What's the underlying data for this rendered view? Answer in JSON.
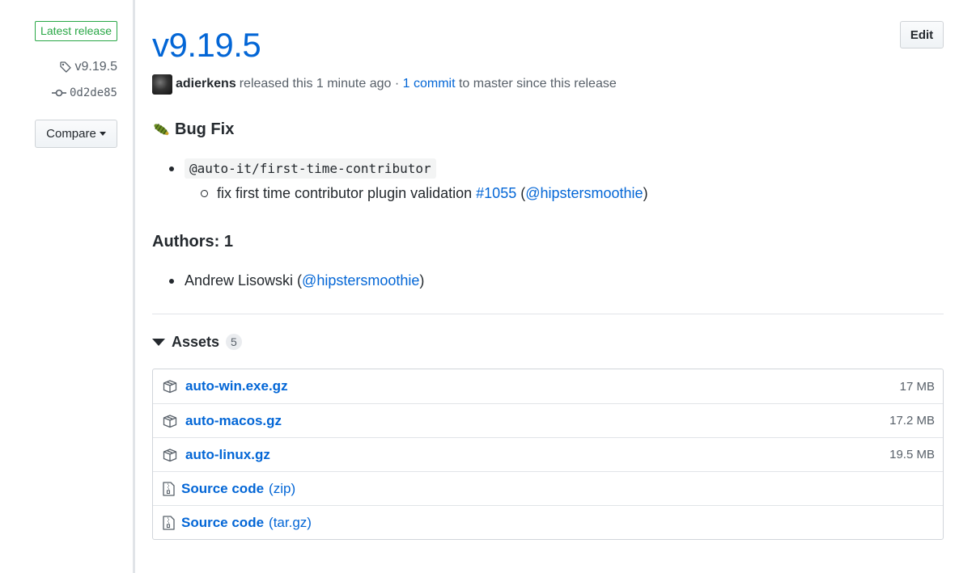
{
  "sidebar": {
    "latest_badge": "Latest release",
    "tag": "v9.19.5",
    "commit": "0d2de85",
    "compare_label": "Compare"
  },
  "release": {
    "title": "v9.19.5",
    "edit_label": "Edit",
    "author": "adierkens",
    "released_text": "released this 1 minute ago ·",
    "commit_link": "1 commit",
    "since_text": "to master since this release"
  },
  "notes": {
    "bug_fix_heading": "Bug Fix",
    "package": "@auto-it/first-time-contributor",
    "fix_text": "fix first time contributor plugin validation",
    "pr_link": "#1055",
    "fix_paren_open": "(",
    "fix_user": "@hipstersmoothie",
    "fix_paren_close": ")",
    "authors_heading": "Authors: 1",
    "author_name": "Andrew Lisowski (",
    "author_user": "@hipstersmoothie",
    "author_close": ")"
  },
  "assets": {
    "label": "Assets",
    "count": "5",
    "files": [
      {
        "name": "auto-win.exe.gz",
        "size": "17 MB",
        "icon": "package-icon"
      },
      {
        "name": "auto-macos.gz",
        "size": "17.2 MB",
        "icon": "package-icon"
      },
      {
        "name": "auto-linux.gz",
        "size": "19.5 MB",
        "icon": "package-icon"
      },
      {
        "name": "Source code",
        "ext": "(zip)",
        "icon": "file-zip-icon"
      },
      {
        "name": "Source code",
        "ext": "(tar.gz)",
        "icon": "file-zip-icon"
      }
    ]
  },
  "colors": {
    "link": "#0366d6",
    "latest_green": "#28a745",
    "text": "#24292e",
    "muted": "#586069"
  }
}
